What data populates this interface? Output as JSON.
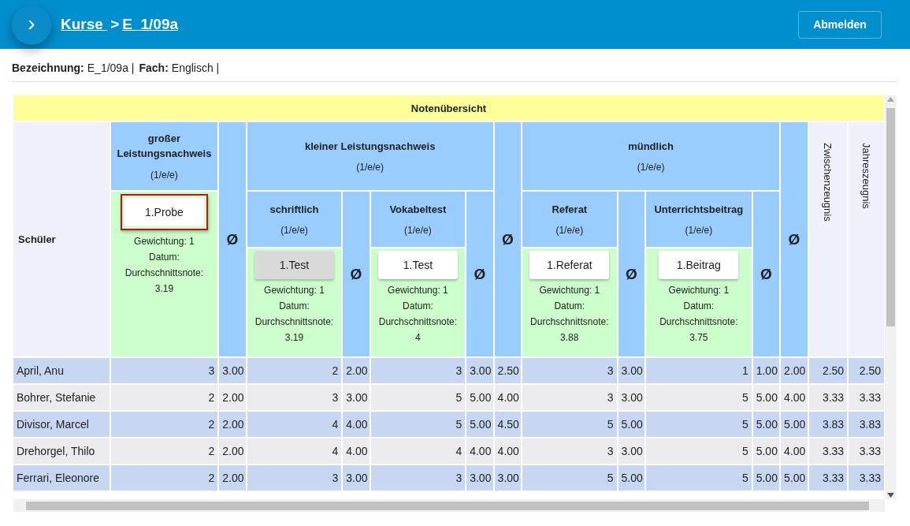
{
  "header": {
    "menu_symbol": "›",
    "breadcrumb": [
      {
        "label": "Kurse "
      },
      {
        "label": "E_1/09a"
      }
    ],
    "separator": ">",
    "logout": "Abmelden"
  },
  "info": [
    {
      "label": "Bezeichnung:",
      "value": "E_1/09a |"
    },
    {
      "label": "Fach:",
      "value": "Englisch |"
    }
  ],
  "table": {
    "title": "Notenübersicht",
    "student_header": "Schüler",
    "groups": [
      {
        "kind": "single",
        "title": "großer Leistungsnachweis",
        "weight": "(1/e/e)",
        "avg_symbol": "Ø",
        "exam": {
          "label": "1.Probe",
          "selected": true,
          "hovered": false,
          "lines": [
            "Gewichtung: 1",
            "Datum:",
            "Durchschnittsnote:",
            "3.19"
          ]
        }
      },
      {
        "kind": "nested",
        "title": "kleiner Leistungsnachweis",
        "weight": "(1/e/e)",
        "avg_symbol": "Ø",
        "subgroups": [
          {
            "title": "schriftlich",
            "weight": "(1/e/e)",
            "avg_symbol": "Ø",
            "exam": {
              "label": "1.Test",
              "selected": false,
              "hovered": true,
              "lines": [
                "Gewichtung: 1",
                "Datum:",
                "Durchschnittsnote:",
                "3.19"
              ]
            }
          },
          {
            "title": "Vokabeltest",
            "weight": "(1/e/e)",
            "avg_symbol": "Ø",
            "exam": {
              "label": "1.Test",
              "selected": false,
              "hovered": false,
              "lines": [
                "Gewichtung: 1",
                "Datum:",
                "Durchschnittsnote:",
                "4"
              ]
            }
          }
        ]
      },
      {
        "kind": "nested",
        "title": "mündlich",
        "weight": "(1/e/e)",
        "avg_symbol": "Ø",
        "subgroups": [
          {
            "title": "Referat",
            "weight": "(1/e/e)",
            "avg_symbol": "Ø",
            "exam": {
              "label": "1.Referat",
              "selected": false,
              "hovered": false,
              "lines": [
                "Gewichtung: 1",
                "Datum:",
                "Durchschnittsnote:",
                "3.88"
              ]
            }
          },
          {
            "title": "Unterrichtsbeitrag",
            "weight": "(1/e/e)",
            "avg_symbol": "Ø",
            "exam": {
              "label": "1.Beitrag",
              "selected": false,
              "hovered": false,
              "lines": [
                "Gewichtung: 1",
                "Datum:",
                "Durchschnittsnote:",
                "3.75"
              ]
            }
          }
        ]
      }
    ],
    "final_columns": [
      "Zwischenzeugnis",
      "Jahreszeugnis"
    ],
    "rows": [
      {
        "name": "April, Anu",
        "cells": [
          "3",
          "3.00",
          "2",
          "2.00",
          "3",
          "3.00",
          "2.50",
          "3",
          "3.00",
          "1",
          "1.00",
          "2.00",
          "2.50",
          "2.50"
        ]
      },
      {
        "name": "Bohrer, Stefanie",
        "cells": [
          "2",
          "2.00",
          "3",
          "3.00",
          "5",
          "5.00",
          "4.00",
          "3",
          "3.00",
          "5",
          "5.00",
          "4.00",
          "3.33",
          "3.33"
        ]
      },
      {
        "name": "Divisor, Marcel",
        "cells": [
          "2",
          "2.00",
          "4",
          "4.00",
          "5",
          "5.00",
          "4.50",
          "5",
          "5.00",
          "5",
          "5.00",
          "5.00",
          "3.83",
          "3.83"
        ]
      },
      {
        "name": "Drehorgel, Thilo",
        "cells": [
          "2",
          "2.00",
          "4",
          "4.00",
          "4",
          "4.00",
          "4.00",
          "3",
          "3.00",
          "5",
          "5.00",
          "4.00",
          "3.33",
          "3.33"
        ]
      },
      {
        "name": "Ferrari, Eleonore",
        "cells": [
          "2",
          "2.00",
          "3",
          "3.00",
          "3",
          "3.00",
          "3.00",
          "5",
          "5.00",
          "5",
          "5.00",
          "5.00",
          "3.33",
          "3.33"
        ]
      }
    ]
  }
}
